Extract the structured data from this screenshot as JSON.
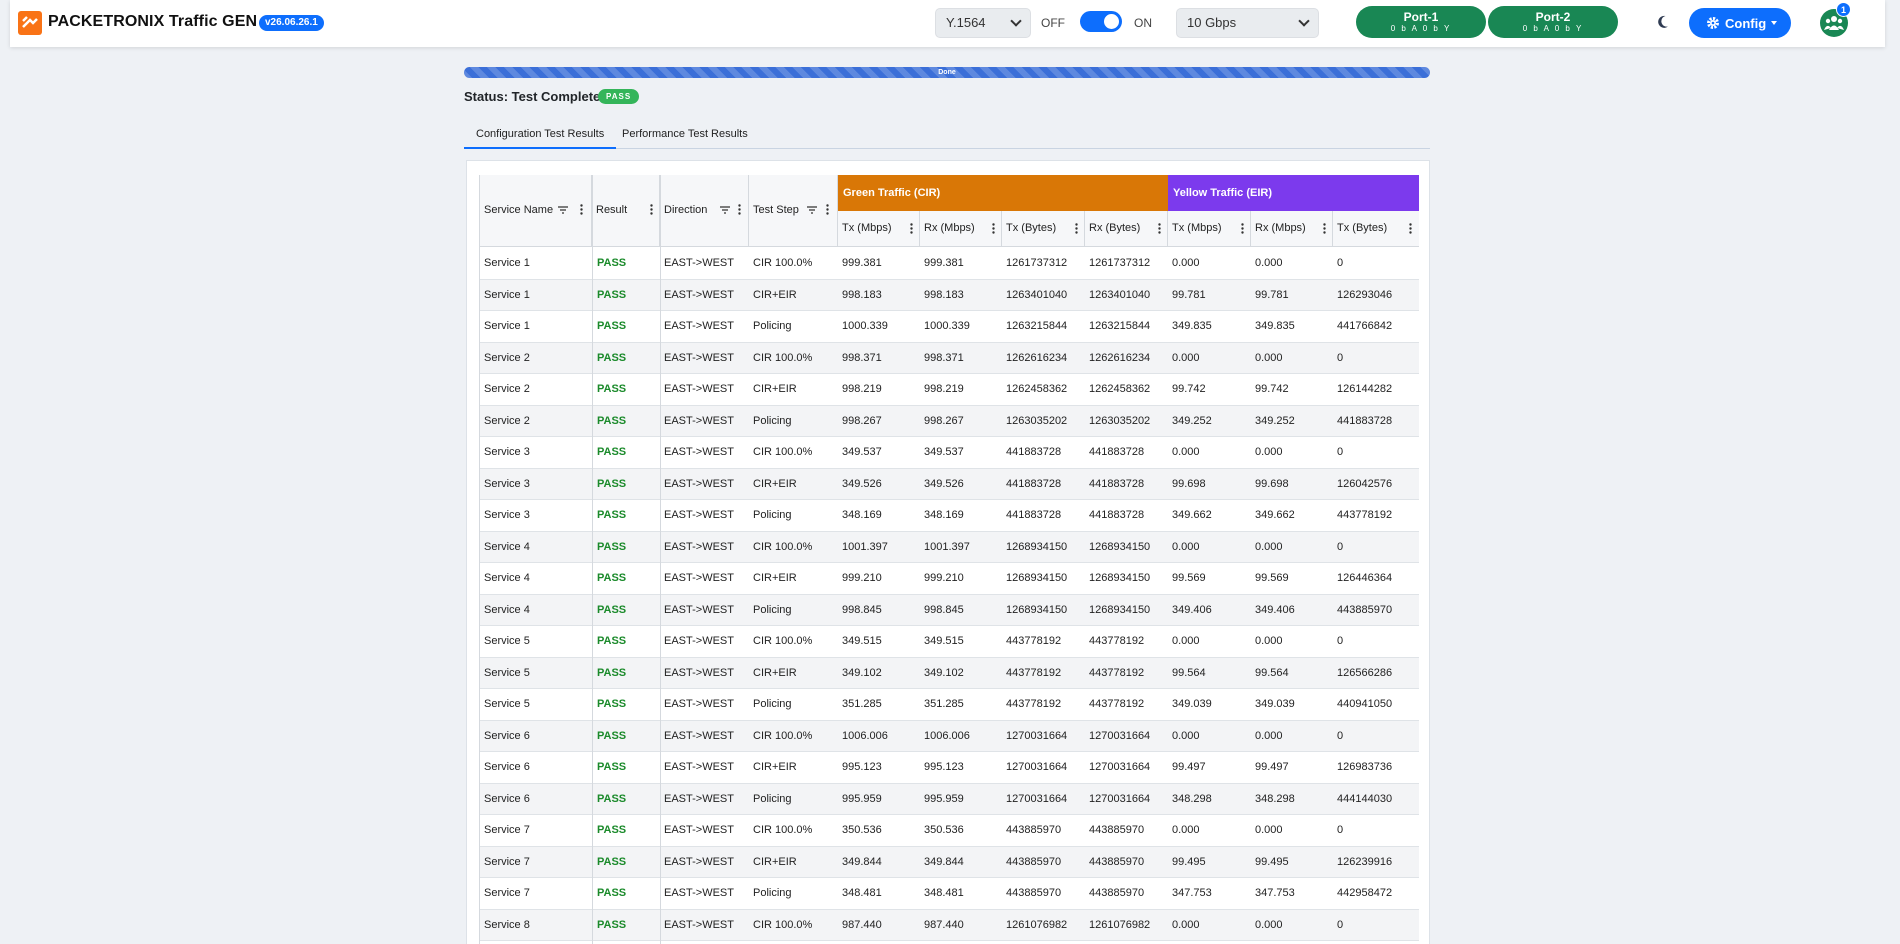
{
  "app": {
    "brand": "PACKETRONIX Traffic GEN",
    "version": "v26.06.26.1",
    "protocol": "Y.1564",
    "toggle_off": "OFF",
    "toggle_on": "ON",
    "speed": "10 Gbps",
    "ports": [
      {
        "name": "Port-1",
        "status": "0 b A   0 b Y"
      },
      {
        "name": "Port-2",
        "status": "0 b A   0 b Y"
      }
    ],
    "config_label": "Config",
    "users_count": "1",
    "colors": {
      "primary": "#0d6efd",
      "port": "#198754",
      "green_group": "#d97706",
      "yellow_group": "#7c3aed",
      "pass": "#1a8a2a"
    }
  },
  "progress": {
    "label": "Done",
    "value": 1.0
  },
  "status": {
    "text": "Status: Test Complete",
    "badge": "PASS"
  },
  "tabs": [
    {
      "label": "Configuration Test Results",
      "active": true
    },
    {
      "label": "Performance Test Results",
      "active": false
    }
  ],
  "table": {
    "groups": {
      "green": "Green Traffic (CIR)",
      "yellow": "Yellow Traffic (EIR)"
    },
    "headers": {
      "service_name": "Service Name",
      "result": "Result",
      "direction": "Direction",
      "test_step": "Test Step",
      "g_tx_mbps": "Tx (Mbps)",
      "g_rx_mbps": "Rx (Mbps)",
      "g_tx_bytes": "Tx (Bytes)",
      "g_rx_bytes": "Rx (Bytes)",
      "y_tx_mbps": "Tx (Mbps)",
      "y_rx_mbps": "Rx (Mbps)",
      "y_tx_bytes": "Tx (Bytes)"
    },
    "rows": [
      [
        "Service 1",
        "PASS",
        "EAST->WEST",
        "CIR 100.0%",
        "999.381",
        "999.381",
        "1261737312",
        "1261737312",
        "0.000",
        "0.000",
        "0"
      ],
      [
        "Service 1",
        "PASS",
        "EAST->WEST",
        "CIR+EIR",
        "998.183",
        "998.183",
        "1263401040",
        "1263401040",
        "99.781",
        "99.781",
        "126293046"
      ],
      [
        "Service 1",
        "PASS",
        "EAST->WEST",
        "Policing",
        "1000.339",
        "1000.339",
        "1263215844",
        "1263215844",
        "349.835",
        "349.835",
        "441766842"
      ],
      [
        "Service 2",
        "PASS",
        "EAST->WEST",
        "CIR 100.0%",
        "998.371",
        "998.371",
        "1262616234",
        "1262616234",
        "0.000",
        "0.000",
        "0"
      ],
      [
        "Service 2",
        "PASS",
        "EAST->WEST",
        "CIR+EIR",
        "998.219",
        "998.219",
        "1262458362",
        "1262458362",
        "99.742",
        "99.742",
        "126144282"
      ],
      [
        "Service 2",
        "PASS",
        "EAST->WEST",
        "Policing",
        "998.267",
        "998.267",
        "1263035202",
        "1263035202",
        "349.252",
        "349.252",
        "441883728"
      ],
      [
        "Service 3",
        "PASS",
        "EAST->WEST",
        "CIR 100.0%",
        "349.537",
        "349.537",
        "441883728",
        "441883728",
        "0.000",
        "0.000",
        "0"
      ],
      [
        "Service 3",
        "PASS",
        "EAST->WEST",
        "CIR+EIR",
        "349.526",
        "349.526",
        "441883728",
        "441883728",
        "99.698",
        "99.698",
        "126042576"
      ],
      [
        "Service 3",
        "PASS",
        "EAST->WEST",
        "Policing",
        "348.169",
        "348.169",
        "441883728",
        "441883728",
        "349.662",
        "349.662",
        "443778192"
      ],
      [
        "Service 4",
        "PASS",
        "EAST->WEST",
        "CIR 100.0%",
        "1001.397",
        "1001.397",
        "1268934150",
        "1268934150",
        "0.000",
        "0.000",
        "0"
      ],
      [
        "Service 4",
        "PASS",
        "EAST->WEST",
        "CIR+EIR",
        "999.210",
        "999.210",
        "1268934150",
        "1268934150",
        "99.569",
        "99.569",
        "126446364"
      ],
      [
        "Service 4",
        "PASS",
        "EAST->WEST",
        "Policing",
        "998.845",
        "998.845",
        "1268934150",
        "1268934150",
        "349.406",
        "349.406",
        "443885970"
      ],
      [
        "Service 5",
        "PASS",
        "EAST->WEST",
        "CIR 100.0%",
        "349.515",
        "349.515",
        "443778192",
        "443778192",
        "0.000",
        "0.000",
        "0"
      ],
      [
        "Service 5",
        "PASS",
        "EAST->WEST",
        "CIR+EIR",
        "349.102",
        "349.102",
        "443778192",
        "443778192",
        "99.564",
        "99.564",
        "126566286"
      ],
      [
        "Service 5",
        "PASS",
        "EAST->WEST",
        "Policing",
        "351.285",
        "351.285",
        "443778192",
        "443778192",
        "349.039",
        "349.039",
        "440941050"
      ],
      [
        "Service 6",
        "PASS",
        "EAST->WEST",
        "CIR 100.0%",
        "1006.006",
        "1006.006",
        "1270031664",
        "1270031664",
        "0.000",
        "0.000",
        "0"
      ],
      [
        "Service 6",
        "PASS",
        "EAST->WEST",
        "CIR+EIR",
        "995.123",
        "995.123",
        "1270031664",
        "1270031664",
        "99.497",
        "99.497",
        "126983736"
      ],
      [
        "Service 6",
        "PASS",
        "EAST->WEST",
        "Policing",
        "995.959",
        "995.959",
        "1270031664",
        "1270031664",
        "348.298",
        "348.298",
        "444144030"
      ],
      [
        "Service 7",
        "PASS",
        "EAST->WEST",
        "CIR 100.0%",
        "350.536",
        "350.536",
        "443885970",
        "443885970",
        "0.000",
        "0.000",
        "0"
      ],
      [
        "Service 7",
        "PASS",
        "EAST->WEST",
        "CIR+EIR",
        "349.844",
        "349.844",
        "443885970",
        "443885970",
        "99.495",
        "99.495",
        "126239916"
      ],
      [
        "Service 7",
        "PASS",
        "EAST->WEST",
        "Policing",
        "348.481",
        "348.481",
        "443885970",
        "443885970",
        "347.753",
        "347.753",
        "442958472"
      ],
      [
        "Service 8",
        "PASS",
        "EAST->WEST",
        "CIR 100.0%",
        "987.440",
        "987.440",
        "1261076982",
        "1261076982",
        "0.000",
        "0.000",
        "0"
      ]
    ]
  }
}
